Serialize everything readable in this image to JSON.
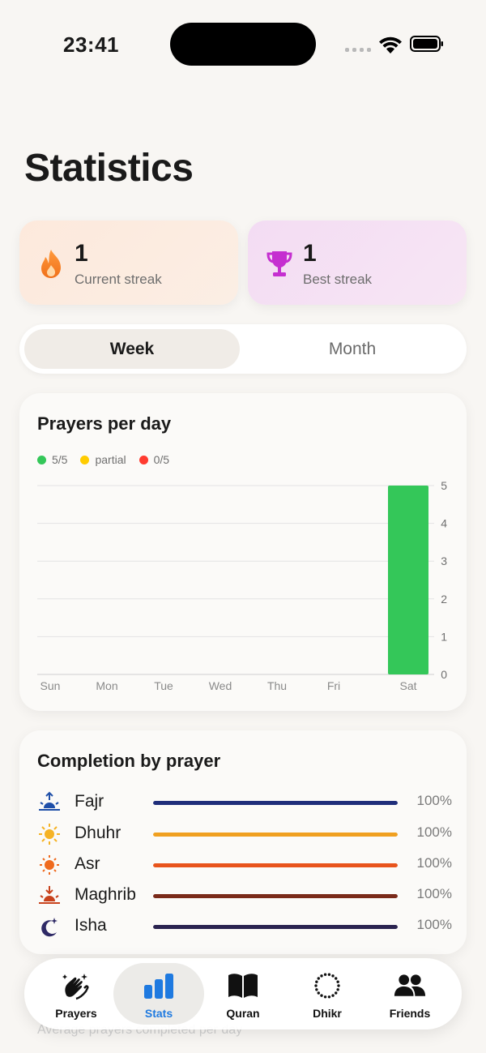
{
  "status_bar": {
    "time": "23:41"
  },
  "page": {
    "title": "Statistics"
  },
  "streaks": {
    "current": {
      "value": "1",
      "label": "Current streak",
      "icon": "flame-icon"
    },
    "best": {
      "value": "1",
      "label": "Best streak",
      "icon": "trophy-icon"
    }
  },
  "segmented": {
    "week": "Week",
    "month": "Month",
    "selected": "Week"
  },
  "prayers_per_day": {
    "title": "Prayers per day",
    "legend": [
      {
        "label": "5/5",
        "color": "#34c759"
      },
      {
        "label": "partial",
        "color": "#ffcc00"
      },
      {
        "label": "0/5",
        "color": "#ff3b30"
      }
    ]
  },
  "chart_data": {
    "type": "bar",
    "title": "Prayers per day",
    "categories": [
      "Sun",
      "Mon",
      "Tue",
      "Wed",
      "Thu",
      "Fri",
      "Sat"
    ],
    "values": [
      0,
      0,
      0,
      0,
      0,
      0,
      5
    ],
    "ylim": [
      0,
      5
    ],
    "yticks": [
      "0",
      "1",
      "2",
      "3",
      "4",
      "5"
    ],
    "bar_color": "#34c759",
    "grid": true
  },
  "completion": {
    "title": "Completion by prayer",
    "rows": [
      {
        "name": "Fajr",
        "pct": "100%",
        "value": 1.0,
        "color": "#1f2e7a",
        "icon": "sunrise-icon"
      },
      {
        "name": "Dhuhr",
        "pct": "100%",
        "value": 1.0,
        "color": "#f0a020",
        "icon": "sun-icon"
      },
      {
        "name": "Asr",
        "pct": "100%",
        "value": 1.0,
        "color": "#e8541c",
        "icon": "sun-small-icon"
      },
      {
        "name": "Maghrib",
        "pct": "100%",
        "value": 1.0,
        "color": "#7a2a1a",
        "icon": "sunset-icon"
      },
      {
        "name": "Isha",
        "pct": "100%",
        "value": 1.0,
        "color": "#2a2350",
        "icon": "moon-icon"
      }
    ]
  },
  "ghost": {
    "text": "Average prayers completed per day"
  },
  "tabs": [
    {
      "label": "Prayers",
      "icon": "praying-hands-icon"
    },
    {
      "label": "Stats",
      "icon": "bar-chart-icon",
      "active": true
    },
    {
      "label": "Quran",
      "icon": "book-icon"
    },
    {
      "label": "Dhikr",
      "icon": "beads-icon"
    },
    {
      "label": "Friends",
      "icon": "people-icon"
    }
  ]
}
